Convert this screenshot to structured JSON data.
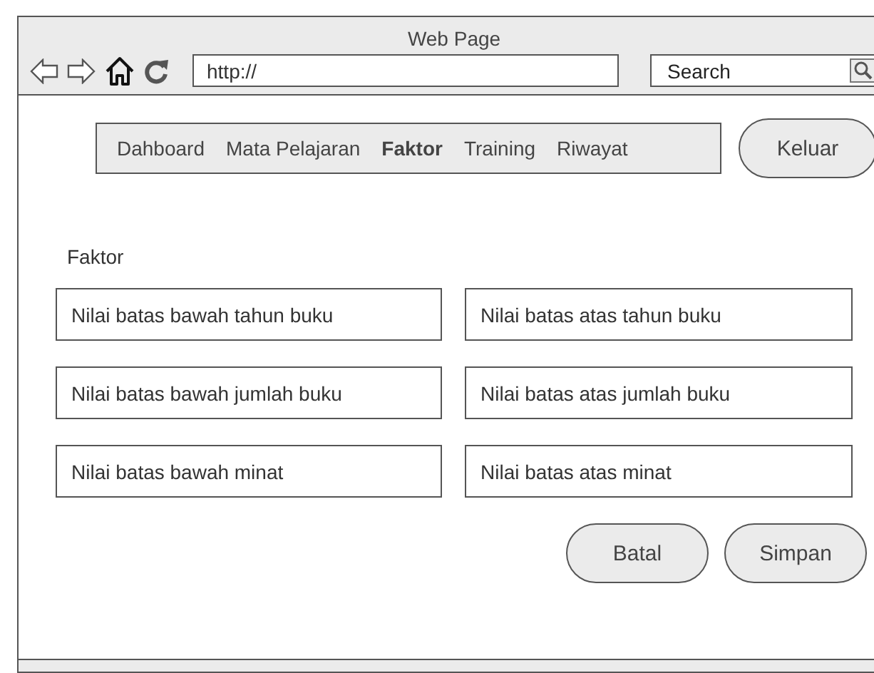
{
  "window": {
    "title": "Web Page"
  },
  "address_bar": {
    "value": "http://"
  },
  "search": {
    "value": "Search"
  },
  "nav": {
    "items": [
      {
        "label": "Dahboard",
        "selected": false
      },
      {
        "label": "Mata Pelajaran",
        "selected": false
      },
      {
        "label": "Faktor",
        "selected": true
      },
      {
        "label": "Training",
        "selected": false
      },
      {
        "label": "Riwayat",
        "selected": false
      }
    ],
    "logout": "Keluar"
  },
  "section_title": "Faktor",
  "fields": [
    {
      "placeholder": "Nilai batas bawah tahun buku"
    },
    {
      "placeholder": "Nilai batas atas tahun buku"
    },
    {
      "placeholder": "Nilai batas bawah jumlah buku"
    },
    {
      "placeholder": "Nilai batas atas jumlah buku"
    },
    {
      "placeholder": "Nilai batas bawah minat"
    },
    {
      "placeholder": "Nilai batas atas minat"
    }
  ],
  "buttons": [
    "Batal",
    "Simpan"
  ]
}
